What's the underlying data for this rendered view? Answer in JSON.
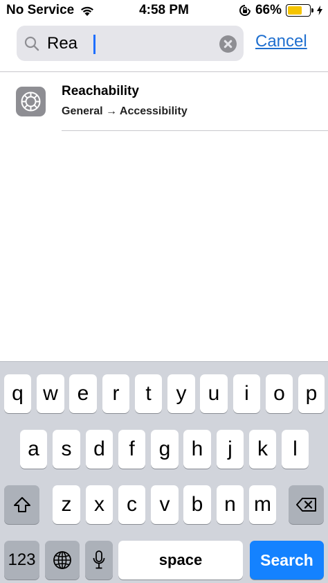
{
  "status_bar": {
    "carrier": "No Service",
    "time": "4:58 PM",
    "battery_percent": "66%",
    "battery_level": 0.66,
    "battery_color": "#f5c400"
  },
  "search": {
    "query": "Rea",
    "cancel_label": "Cancel"
  },
  "results": [
    {
      "icon": "gear-icon",
      "title": "Reachability",
      "subtitle": "General → Accessibility"
    }
  ],
  "keyboard": {
    "row1": [
      "q",
      "w",
      "e",
      "r",
      "t",
      "y",
      "u",
      "i",
      "o",
      "p"
    ],
    "row2": [
      "a",
      "s",
      "d",
      "f",
      "g",
      "h",
      "j",
      "k",
      "l"
    ],
    "row3": [
      "z",
      "x",
      "c",
      "v",
      "b",
      "n",
      "m"
    ],
    "numbers_label": "123",
    "space_label": "space",
    "search_label": "Search",
    "accent_color": "#1482ff"
  }
}
